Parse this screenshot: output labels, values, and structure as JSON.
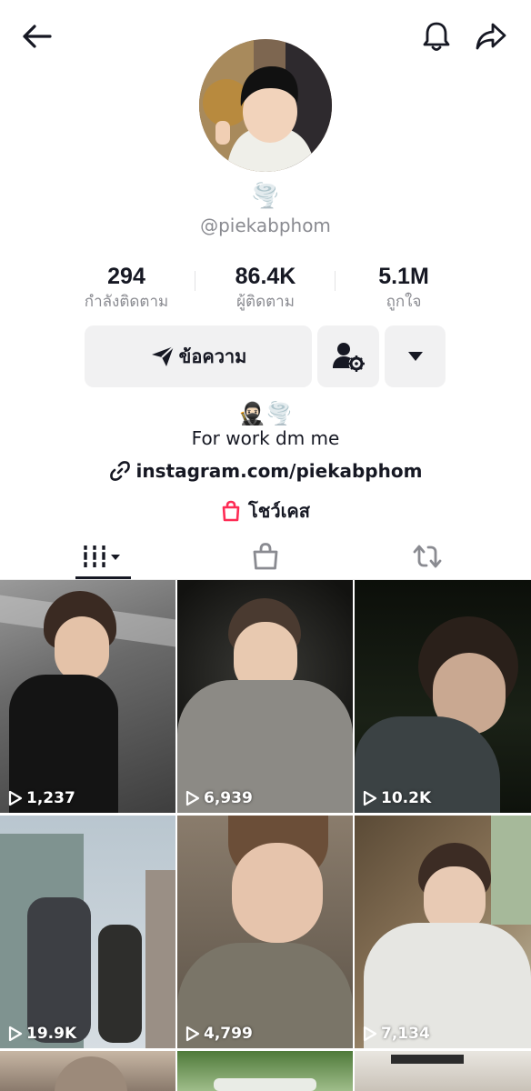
{
  "profile": {
    "handle_emoji": "🌪️",
    "handle": "@piekabphom",
    "bio_emoji": "🥷🏻🌪️",
    "bio": "For work dm me",
    "link": "instagram.com/piekabphom",
    "showcase": "โชว์เคส"
  },
  "stats": [
    {
      "value": "294",
      "label": "กำลังติดตาม"
    },
    {
      "value": "86.4K",
      "label": "ผู้ติดตาม"
    },
    {
      "value": "5.1M",
      "label": "ถูกใจ"
    }
  ],
  "actions": {
    "message_label": "ข้อความ"
  },
  "icons": {
    "back": "back-arrow-icon",
    "bell": "bell-icon",
    "share": "share-icon",
    "send": "send-icon",
    "person_settings": "person-settings-icon",
    "dropdown": "caret-down-icon",
    "link": "link-icon",
    "shopping_bag": "shopping-bag-icon",
    "videos_grid": "videos-grid-icon",
    "repost": "repost-icon",
    "play": "play-icon"
  },
  "videos": [
    {
      "views": "1,237"
    },
    {
      "views": "6,939"
    },
    {
      "views": "10.2K"
    },
    {
      "views": "19.9K"
    },
    {
      "views": "4,799"
    },
    {
      "views": "7,134"
    },
    {
      "views": ""
    },
    {
      "views": ""
    },
    {
      "views": ""
    }
  ],
  "colors": {
    "text": "#161823",
    "secondary": "#8a8b91",
    "button_bg": "#f1f1f2",
    "shop_pink": "#fe2c55"
  }
}
